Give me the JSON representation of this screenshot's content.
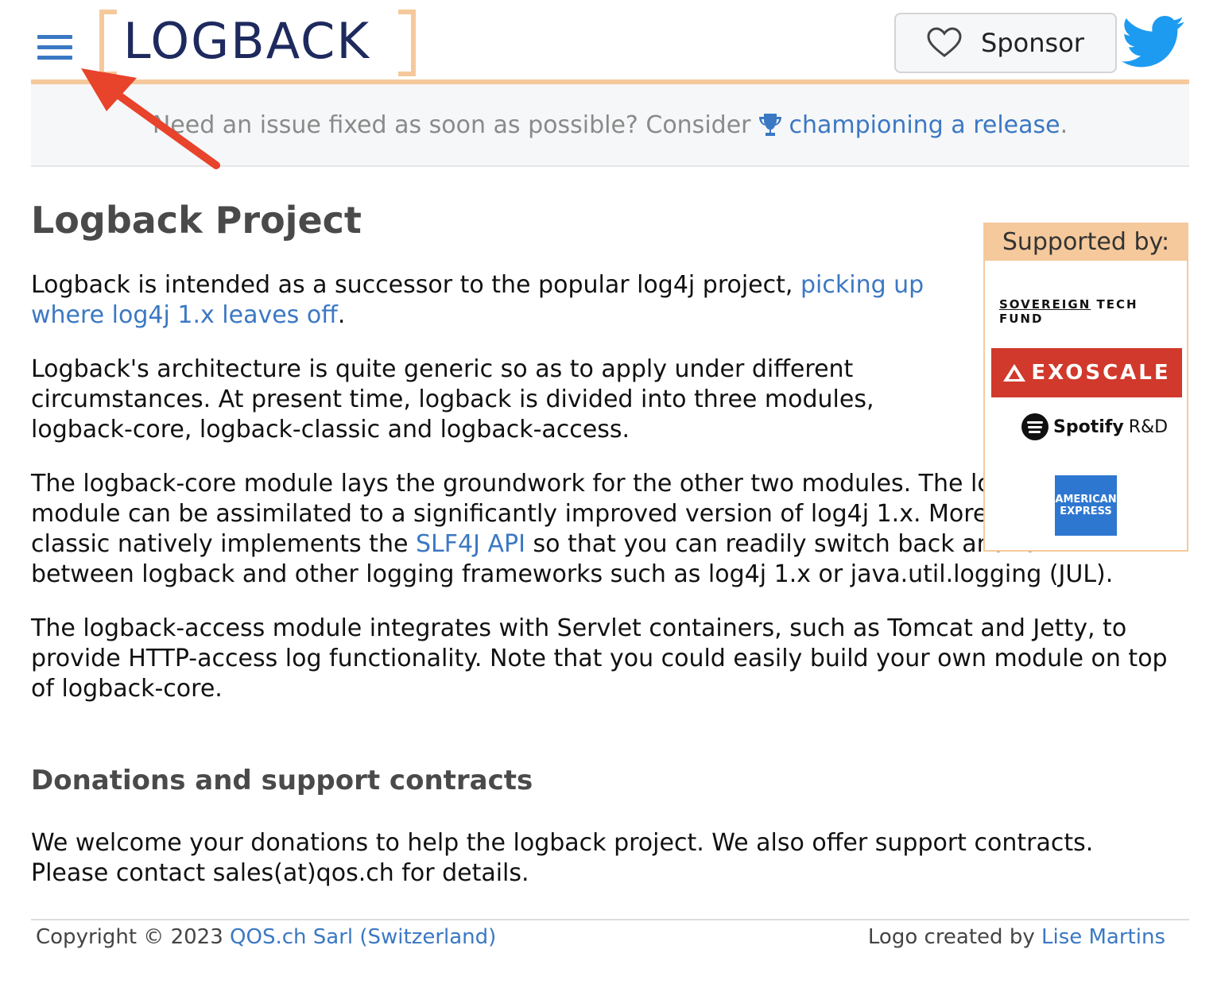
{
  "header": {
    "logo_text": "LOGBACK",
    "sponsor_label": "Sponsor"
  },
  "banner": {
    "text_before": "Need an issue fixed as soon as possible? Consider",
    "link_text": "championing a release",
    "text_after": "."
  },
  "main": {
    "title": "Logback Project",
    "p1_text": "Logback is intended as a successor to the popular log4j project,",
    "p1_link": "picking up where log4j 1.x leaves off",
    "p1_end": ".",
    "p2": "Logback's architecture is quite generic so as to apply under different circumstances. At present time, logback is divided into three modules, logback-core, logback-classic and logback-access.",
    "p3_text": "The logback-core module lays the groundwork for the other two modules. The logback-classic module can be assimilated to a significantly improved version of log4j 1.x. Moreover, logback-classic natively implements the",
    "p3_link": "SLF4J API",
    "p3_end": "so that you can readily switch back and forth between logback and other logging frameworks such as log4j 1.x or java.util.logging (JUL).",
    "p4": "The logback-access module integrates with Servlet containers, such as Tomcat and Jetty, to provide HTTP-access log functionality. Note that you could easily build your own module on top of logback-core.",
    "donations_title": "Donations and support contracts",
    "donations_text": "We welcome your donations to help the logback project. We also offer support contracts. Please contact sales(at)qos.ch for details."
  },
  "supported": {
    "heading": "Supported by:",
    "stf_a": "SOVEREIGN",
    "stf_b": "TECH FUND",
    "exoscale": "EXOSCALE",
    "spotify_a": "Spotify",
    "spotify_b": "R&D",
    "amex_a": "AMERICAN",
    "amex_b": "EXPRESS"
  },
  "footer": {
    "copyright_text": "Copyright © 2023",
    "copyright_link": "QOS.ch Sarl (Switzerland)",
    "logo_credit_text": "Logo created by",
    "logo_credit_link": "Lise Martins"
  },
  "colors": {
    "link": "#3b78c4",
    "accent": "#f5c99c",
    "annotation_arrow": "#e8432b"
  },
  "icons": [
    "hamburger-menu-icon",
    "heart-icon",
    "twitter-bird-icon",
    "trophy-icon",
    "annotation-arrow"
  ]
}
